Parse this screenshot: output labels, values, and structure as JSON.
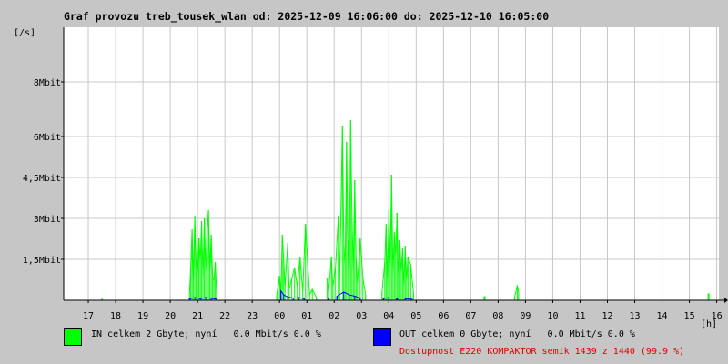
{
  "chart_data": {
    "type": "area",
    "title": "Graf provozu treb_tousek_wlan od: 2025-12-09 16:06:00 do: 2025-12-10 16:05:00",
    "ylabel": "[/s]",
    "xlabel": "[h]",
    "y_unit": "Mbit",
    "ylim": [
      0,
      10
    ],
    "y_ticks": [
      {
        "value": 1.5,
        "label": "1,5Mbit"
      },
      {
        "value": 3,
        "label": "3Mbit"
      },
      {
        "value": 4.5,
        "label": "4,5Mbit"
      },
      {
        "value": 6,
        "label": "6Mbit"
      },
      {
        "value": 8,
        "label": "8Mbit"
      }
    ],
    "x_ticks": [
      "17",
      "18",
      "19",
      "20",
      "21",
      "22",
      "23",
      "00",
      "01",
      "02",
      "03",
      "04",
      "05",
      "06",
      "07",
      "08",
      "09",
      "10",
      "11",
      "12",
      "13",
      "14",
      "15",
      "16"
    ],
    "x_range_hours": [
      16.1,
      40.08
    ],
    "grid": true,
    "series": [
      {
        "name": "IN",
        "color": "#00ff00",
        "style": "spikes",
        "points": [
          [
            17.5,
            0.05
          ],
          [
            20.7,
            0.1
          ],
          [
            20.75,
            1.2
          ],
          [
            20.8,
            2.6
          ],
          [
            20.85,
            0.7
          ],
          [
            20.9,
            3.1
          ],
          [
            20.95,
            1.3
          ],
          [
            21.0,
            0.9
          ],
          [
            21.05,
            2.3
          ],
          [
            21.1,
            1.4
          ],
          [
            21.15,
            2.9
          ],
          [
            21.2,
            0.8
          ],
          [
            21.25,
            3.0
          ],
          [
            21.3,
            1.0
          ],
          [
            21.35,
            2.6
          ],
          [
            21.4,
            3.3
          ],
          [
            21.45,
            1.1
          ],
          [
            21.5,
            2.4
          ],
          [
            21.55,
            0.9
          ],
          [
            21.6,
            0.7
          ],
          [
            21.65,
            1.4
          ],
          [
            21.7,
            0.2
          ],
          [
            23.9,
            0.2
          ],
          [
            24.0,
            0.9
          ],
          [
            24.05,
            0.3
          ],
          [
            24.1,
            2.4
          ],
          [
            24.15,
            1.5
          ],
          [
            24.2,
            0.5
          ],
          [
            24.3,
            2.1
          ],
          [
            24.35,
            0.4
          ],
          [
            24.45,
            0.8
          ],
          [
            24.55,
            1.2
          ],
          [
            24.65,
            0.5
          ],
          [
            24.75,
            1.6
          ],
          [
            24.85,
            0.3
          ],
          [
            24.95,
            2.8
          ],
          [
            25.1,
            0.2
          ],
          [
            25.2,
            0.4
          ],
          [
            25.35,
            0.1
          ],
          [
            25.75,
            0.8
          ],
          [
            25.8,
            0.3
          ],
          [
            25.9,
            1.6
          ],
          [
            25.95,
            0.5
          ],
          [
            26.05,
            1.2
          ],
          [
            26.15,
            3.1
          ],
          [
            26.2,
            0.7
          ],
          [
            26.3,
            6.4
          ],
          [
            26.35,
            2.0
          ],
          [
            26.4,
            1.3
          ],
          [
            26.45,
            5.8
          ],
          [
            26.5,
            2.2
          ],
          [
            26.55,
            0.8
          ],
          [
            26.6,
            6.6
          ],
          [
            26.65,
            3.0
          ],
          [
            26.7,
            1.1
          ],
          [
            26.75,
            4.4
          ],
          [
            26.8,
            1.5
          ],
          [
            26.85,
            0.6
          ],
          [
            26.95,
            2.3
          ],
          [
            27.05,
            0.8
          ],
          [
            27.15,
            0.2
          ],
          [
            27.75,
            0.3
          ],
          [
            27.85,
            1.4
          ],
          [
            27.9,
            2.8
          ],
          [
            27.95,
            0.6
          ],
          [
            28.0,
            3.3
          ],
          [
            28.05,
            1.2
          ],
          [
            28.1,
            4.6
          ],
          [
            28.15,
            0.9
          ],
          [
            28.2,
            2.5
          ],
          [
            28.25,
            1.6
          ],
          [
            28.3,
            3.2
          ],
          [
            28.35,
            0.8
          ],
          [
            28.4,
            2.2
          ],
          [
            28.45,
            1.0
          ],
          [
            28.5,
            1.9
          ],
          [
            28.55,
            0.5
          ],
          [
            28.6,
            2.0
          ],
          [
            28.65,
            0.7
          ],
          [
            28.7,
            1.6
          ],
          [
            28.8,
            1.3
          ],
          [
            28.9,
            0.3
          ],
          [
            31.5,
            0.15
          ],
          [
            32.6,
            0.1
          ],
          [
            32.7,
            0.55
          ],
          [
            32.75,
            0.3
          ],
          [
            39.7,
            0.25
          ]
        ]
      },
      {
        "name": "OUT",
        "color": "#0000ff",
        "style": "spikes",
        "points": [
          [
            20.7,
            0.05
          ],
          [
            20.9,
            0.1
          ],
          [
            21.1,
            0.06
          ],
          [
            21.3,
            0.1
          ],
          [
            21.5,
            0.07
          ],
          [
            21.7,
            0.04
          ],
          [
            24.05,
            0.35
          ],
          [
            24.15,
            0.2
          ],
          [
            24.3,
            0.12
          ],
          [
            24.5,
            0.08
          ],
          [
            24.7,
            0.1
          ],
          [
            24.9,
            0.06
          ],
          [
            25.8,
            0.1
          ],
          [
            26.1,
            0.15
          ],
          [
            26.35,
            0.3
          ],
          [
            26.55,
            0.2
          ],
          [
            26.75,
            0.15
          ],
          [
            26.95,
            0.08
          ],
          [
            27.8,
            0.06
          ],
          [
            28.0,
            0.1
          ],
          [
            28.3,
            0.08
          ],
          [
            28.6,
            0.06
          ],
          [
            28.85,
            0.04
          ]
        ]
      }
    ]
  },
  "legend": {
    "in": {
      "label": "IN celkem 2 Gbyte; nyní   0.0 Mbit/s 0.0 %",
      "color": "#00ff00"
    },
    "out": {
      "label": "OUT celkem 0 Gbyte; nyní   0.0 Mbit/s 0.0 %",
      "color": "#0000ff"
    }
  },
  "availability": {
    "text": "Dostupnost E220 KOMPAKTOR semik 1439 z 1440 (99.9 %)",
    "color": "#e00000"
  }
}
